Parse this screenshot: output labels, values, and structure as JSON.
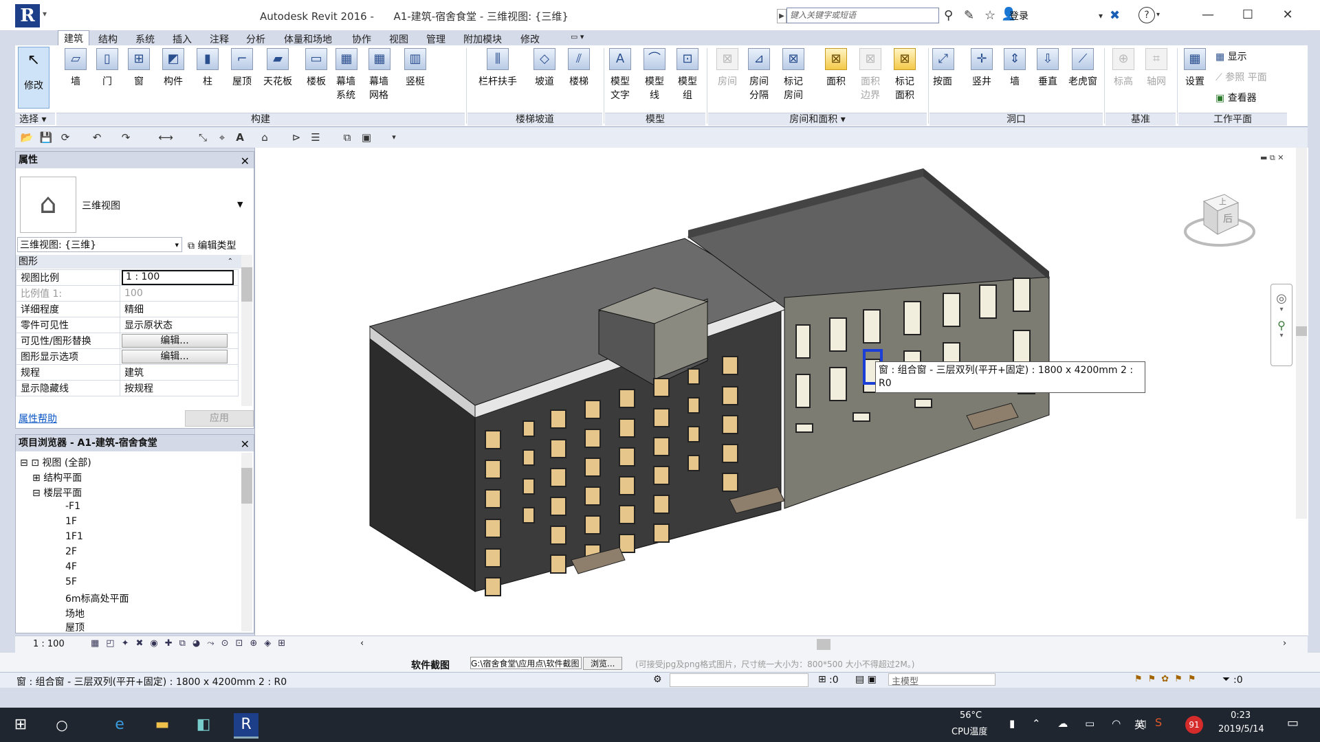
{
  "window": {
    "title": "Autodesk Revit 2016 -",
    "document": "A1-建筑-宿舍食堂 - 三维视图: {三维}",
    "search_placeholder": "键入关键字或短语",
    "login": "登录",
    "min": "—",
    "max": "☐",
    "close": "✕"
  },
  "ribbon_tabs": [
    "建筑",
    "结构",
    "系统",
    "插入",
    "注释",
    "分析",
    "体量和场地",
    "协作",
    "视图",
    "管理",
    "附加模块",
    "修改"
  ],
  "ribbon": {
    "modify": "修改",
    "select_label": "选择",
    "build": [
      "墙",
      "门",
      "窗",
      "构件",
      "柱",
      "屋顶",
      "天花板",
      "楼板",
      "幕墙系统",
      "幕墙网格",
      "竖梃"
    ],
    "stairs": [
      "栏杆扶手",
      "坡道",
      "楼梯"
    ],
    "model": [
      "模型文字",
      "模型线",
      "模型组"
    ],
    "room": [
      "房间",
      "房间分隔",
      "标记房间",
      "面积",
      "面积边界",
      "标记面积"
    ],
    "opening": [
      "按面",
      "竖井",
      "墙",
      "垂直",
      "老虎窗"
    ],
    "datum": [
      "标高",
      "轴网"
    ],
    "workplane": {
      "set": "设置",
      "show": "显示",
      "ref": "参照 平面",
      "viewer": "查看器"
    },
    "panels": [
      "构建",
      "楼梯坡道",
      "模型",
      "房间和面积 ▾",
      "洞口",
      "基准",
      "工作平面"
    ]
  },
  "properties": {
    "header": "属性",
    "type_name": "三维视图",
    "view_selector": "三维视图: {三维}",
    "edit_type": "编辑类型",
    "group": "图形",
    "rows": [
      {
        "k": "视图比例",
        "v": "1 : 100"
      },
      {
        "k": "比例值 1:",
        "v": "100"
      },
      {
        "k": "详细程度",
        "v": "精细"
      },
      {
        "k": "零件可见性",
        "v": "显示原状态"
      },
      {
        "k": "可见性/图形替换",
        "v": "编辑..."
      },
      {
        "k": "图形显示选项",
        "v": "编辑..."
      },
      {
        "k": "规程",
        "v": "建筑"
      },
      {
        "k": "显示隐藏线",
        "v": "按规程"
      }
    ],
    "help": "属性帮助",
    "apply": "应用"
  },
  "browser": {
    "header": "项目浏览器 - A1-建筑-宿舍食堂",
    "root": "视图 (全部)",
    "structural": "结构平面",
    "floors": "楼层平面",
    "levels": [
      "-F1",
      "1F",
      "1F1",
      "2F",
      "4F",
      "5F",
      "6m标高处平面",
      "场地",
      "屋顶"
    ]
  },
  "viewport": {
    "tooltip": "窗 : 组合窗 - 三层双列(平开+固定) : 1800 x 4200mm 2 : R0",
    "viewcube_faces": [
      "上",
      "后"
    ]
  },
  "view_control": {
    "scale": "1 : 100"
  },
  "status": {
    "message": "窗 : 组合窗 - 三层双列(平开+固定) : 1800 x 4200mm 2 : R0",
    "count": ":0",
    "model": "主模型",
    "filter": ":0",
    "behind": "软件截图",
    "behind_path": "G:\\宿舍食堂\\应用点\\软件截图",
    "behind_btn": "浏览...",
    "behind_note": "(可接受jpg及png格式图片，尺寸统一大小为：800*500 大小不得超过2M。)"
  },
  "taskbar": {
    "temp": "56°C",
    "temp_label": "CPU温度",
    "ime": "英",
    "badge": "91",
    "time": "0:23",
    "date": "2019/5/14"
  }
}
